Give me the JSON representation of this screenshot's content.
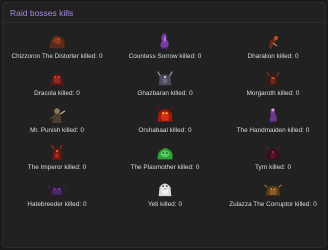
{
  "panel": {
    "title": "Raid bosses kills"
  },
  "bosses": [
    {
      "name": "Chizzoron The Distorter killed:",
      "kills": "0",
      "icon": "chizzoron-sprite-icon"
    },
    {
      "name": "Countess Sorrow killed:",
      "kills": "0",
      "icon": "countess-sorrow-sprite-icon"
    },
    {
      "name": "Dharalion killed:",
      "kills": "0",
      "icon": "dharalion-sprite-icon"
    },
    {
      "name": "Dracola killed:",
      "kills": "0",
      "icon": "dracola-sprite-icon"
    },
    {
      "name": "Ghazbaran killed:",
      "kills": "0",
      "icon": "ghazbaran-sprite-icon"
    },
    {
      "name": "Morgaroth killed:",
      "kills": "0",
      "icon": "morgaroth-sprite-icon"
    },
    {
      "name": "Mr. Punish killed:",
      "kills": "0",
      "icon": "mr-punish-sprite-icon"
    },
    {
      "name": "Orshabaal killed:",
      "kills": "0",
      "icon": "orshabaal-sprite-icon"
    },
    {
      "name": "The Handmaiden killed:",
      "kills": "0",
      "icon": "handmaiden-sprite-icon"
    },
    {
      "name": "The Imperor killed:",
      "kills": "0",
      "icon": "imperor-sprite-icon"
    },
    {
      "name": "The Plasmother killed:",
      "kills": "0",
      "icon": "plasmother-sprite-icon"
    },
    {
      "name": "Tyrn killed:",
      "kills": "0",
      "icon": "tyrn-sprite-icon"
    },
    {
      "name": "Hatebreeder killed:",
      "kills": "0",
      "icon": "hatebreeder-sprite-icon"
    },
    {
      "name": "Yeti killed:",
      "kills": "0",
      "icon": "yeti-sprite-icon"
    },
    {
      "name": "Zulazza The Corruptor killed:",
      "kills": "0",
      "icon": "zulazza-sprite-icon"
    }
  ],
  "colors": {
    "accent": "#a58ae6",
    "panel_bg": "#212121",
    "text": "#dcdcdc"
  }
}
